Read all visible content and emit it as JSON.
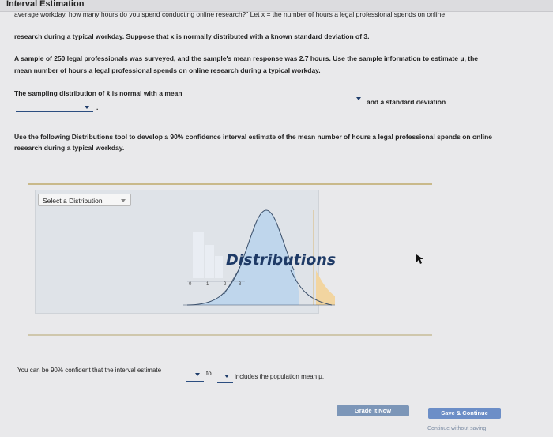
{
  "window": {
    "title": "Interval Estimation"
  },
  "question": {
    "lines": [
      "average workday, how many hours do you spend conducting online research?\" Let x = the number of hours a legal professional spends on online",
      "research during a typical workday. Suppose that x is normally distributed with a known standard deviation of 3.",
      "A sample of 250 legal professionals was surveyed, and the sample's mean response was 2.7 hours. Use the sample information to estimate μ, the",
      "mean number of hours a legal professional spends on online research during a typical workday."
    ]
  },
  "sampling": {
    "prefix": "The sampling distribution of x̄ is normal with a mean",
    "mid": "and a standard deviation",
    "suffix": "."
  },
  "tool_instruction": {
    "lines": [
      "Use the following Distributions tool to develop a 90% confidence interval estimate of the mean number of hours a legal professional spends on online",
      "research during a typical workday."
    ]
  },
  "tool": {
    "select_label": "Select a Distribution",
    "dist_label": "Distributions",
    "axis_ticks": [
      "0",
      "1",
      "2",
      "3"
    ]
  },
  "confidence": {
    "prefix": "You can be 90% confident that the interval estimate",
    "to": "to",
    "suffix": "includes the population mean μ."
  },
  "buttons": {
    "grade": "Grade It Now",
    "save": "Save & Continue",
    "note": "Continue without saving"
  }
}
